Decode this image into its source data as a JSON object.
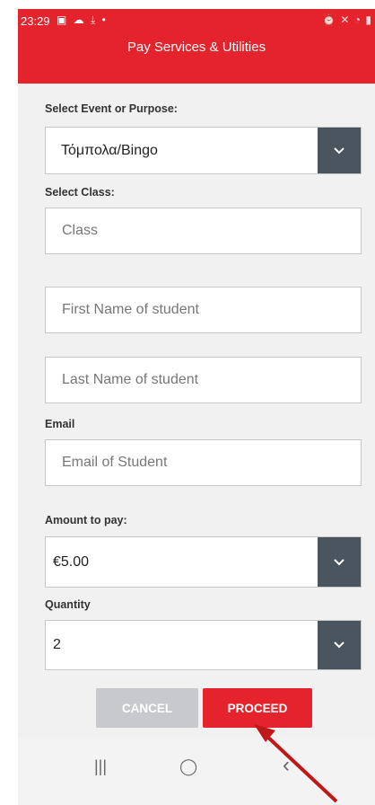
{
  "status_bar": {
    "time": "23:29",
    "left_icons": "▣ ☁ ⤓ •",
    "right_icons": "⏰ ✕ ◔ ▮"
  },
  "header": {
    "title": "Pay Services & Utilities"
  },
  "form": {
    "event_label": "Select Event or Purpose:",
    "event_value": "Τόμπολα/Bingo",
    "class_label": "Select Class:",
    "class_placeholder": "Class",
    "first_name_placeholder": "First Name of student",
    "last_name_placeholder": "Last Name of student",
    "email_label": "Email",
    "email_placeholder": "Email of Student",
    "amount_label": "Amount to pay:",
    "amount_value": "€5.00",
    "quantity_label": "Quantity",
    "quantity_value": "2"
  },
  "buttons": {
    "cancel": "CANCEL",
    "proceed": "PROCEED"
  },
  "navbar": {
    "recents": "|||",
    "home": "◯",
    "back": "‹"
  },
  "colors": {
    "brand_red": "#e4232d",
    "dropdown_dark": "#4a5560",
    "cancel_gray": "#c7c9cc",
    "arrow_red": "#c01818"
  }
}
